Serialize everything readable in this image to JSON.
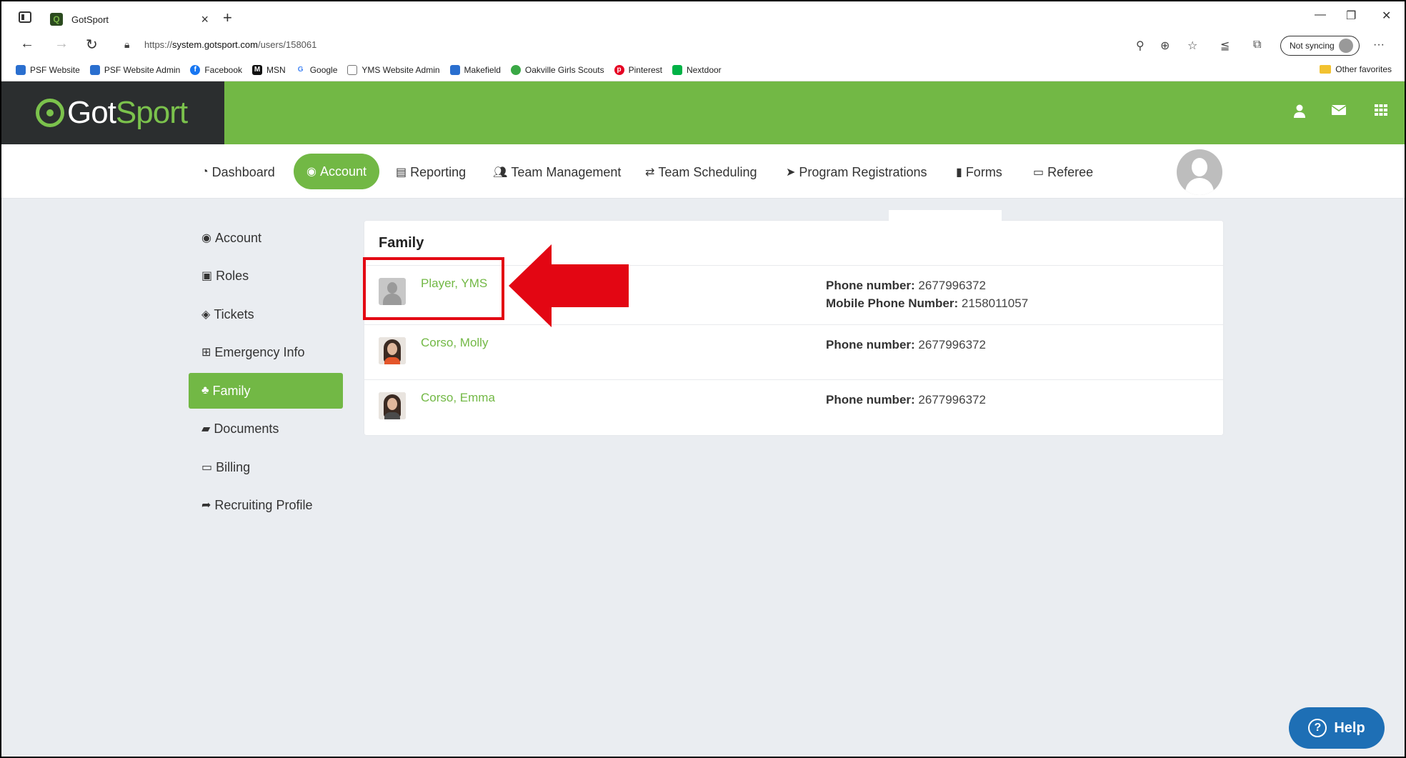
{
  "browser": {
    "tab_title": "GotSport",
    "url_prefix": "https://",
    "url_host": "system.gotsport.com",
    "url_path": "/users/158061",
    "sync_label": "Not syncing",
    "favorites": [
      {
        "label": "PSF Website",
        "color": "#2a6fcf"
      },
      {
        "label": "PSF Website Admin",
        "color": "#2a6fcf"
      },
      {
        "label": "Facebook",
        "color": "#1877f2"
      },
      {
        "label": "MSN",
        "color": "#111111"
      },
      {
        "label": "Google",
        "color": "#4285f4"
      },
      {
        "label": "YMS Website Admin",
        "color": "#777777"
      },
      {
        "label": "Makefield",
        "color": "#2a6fcf"
      },
      {
        "label": "Oakville Girls Scouts",
        "color": "#3aa845"
      },
      {
        "label": "Pinterest",
        "color": "#e60023"
      },
      {
        "label": "Nextdoor",
        "color": "#00b246"
      }
    ],
    "other_favorites": "Other favorites"
  },
  "header": {
    "logo_got": "Got",
    "logo_sport": "Sport"
  },
  "nav": {
    "items": [
      {
        "label": "Dashboard",
        "icon": "tachometer-icon"
      },
      {
        "label": "Account",
        "icon": "user-circle-icon"
      },
      {
        "label": "Reporting",
        "icon": "document-icon"
      },
      {
        "label": "Team Management",
        "icon": "users-icon"
      },
      {
        "label": "Team Scheduling",
        "icon": "exchange-icon"
      },
      {
        "label": "Program Registrations",
        "icon": "paper-plane-icon"
      },
      {
        "label": "Forms",
        "icon": "file-icon"
      },
      {
        "label": "Referee",
        "icon": "calendar-icon"
      }
    ]
  },
  "sidebar": {
    "items": [
      {
        "label": "Account"
      },
      {
        "label": "Roles"
      },
      {
        "label": "Tickets"
      },
      {
        "label": "Emergency Info"
      },
      {
        "label": "Family"
      },
      {
        "label": "Documents"
      },
      {
        "label": "Billing"
      },
      {
        "label": "Recruiting Profile"
      }
    ]
  },
  "family": {
    "title": "Family",
    "phone_label": "Phone number:",
    "mobile_label": "Mobile Phone Number:",
    "members": [
      {
        "name": "Player, YMS",
        "phone": "2677996372",
        "mobile": "2158011057"
      },
      {
        "name": "Corso, Molly",
        "phone": "2677996372"
      },
      {
        "name": "Corso, Emma",
        "phone": "2677996372"
      }
    ]
  },
  "help": {
    "label": "Help"
  },
  "colors": {
    "brand_green": "#72b845",
    "dark": "#2b2e2f",
    "annotation_red": "#e30613",
    "help_blue": "#1e6fb5"
  }
}
